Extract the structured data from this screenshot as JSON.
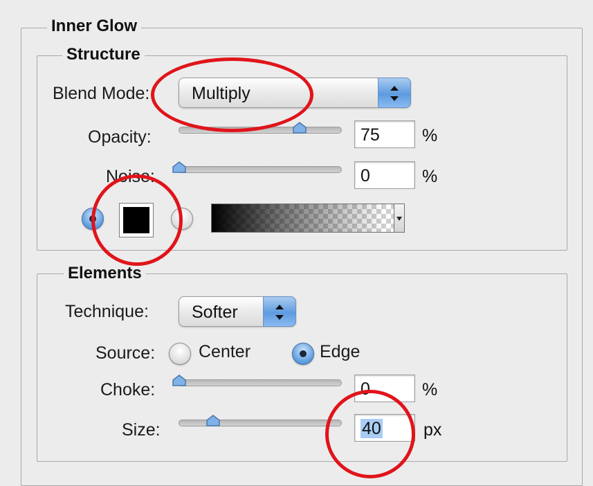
{
  "panel": {
    "title": "Inner Glow"
  },
  "structure": {
    "title": "Structure",
    "blend_mode": {
      "label": "Blend Mode:",
      "value": "Multiply"
    },
    "opacity": {
      "label": "Opacity:",
      "value": "75",
      "unit": "%",
      "level": 0.75
    },
    "noise": {
      "label": "Noise:",
      "value": "0",
      "unit": "%",
      "level": 0
    },
    "color_swatch": "#000000"
  },
  "elements": {
    "title": "Elements",
    "technique": {
      "label": "Technique:",
      "value": "Softer"
    },
    "source": {
      "label": "Source:",
      "center": "Center",
      "edge": "Edge",
      "selected": "Edge"
    },
    "choke": {
      "label": "Choke:",
      "value": "0",
      "unit": "%",
      "level": 0
    },
    "size": {
      "label": "Size:",
      "value": "40",
      "unit": "px",
      "level": 0.2
    }
  },
  "annotation_color": "#e0141a"
}
